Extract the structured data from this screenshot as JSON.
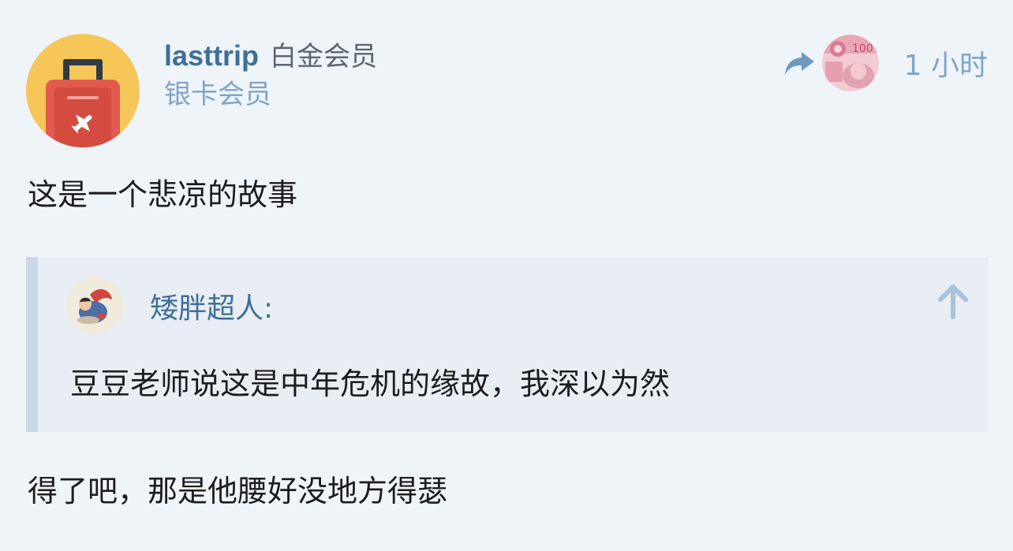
{
  "post": {
    "author": {
      "username": "lasttrip",
      "tier_primary": "白金会员",
      "tier_secondary": "银卡会员",
      "avatar_icon": "suitcase-icon"
    },
    "meta": {
      "share_icon": "share-arrow-icon",
      "time": "1 小时"
    },
    "body_first": "这是一个悲凉的故事",
    "quote": {
      "author": "矮胖超人:",
      "text": "豆豆老师说这是中年危机的缘故，我深以为然",
      "jump_icon": "arrow-up-icon"
    },
    "body_last": "得了吧，那是他腰好没地方得瑟"
  },
  "colors": {
    "background": "#eff4f9",
    "link_blue": "#3f6f9a",
    "muted_blue": "#7fa6c7",
    "quote_bg": "#e8eef3",
    "quote_border": "#c7d8e7",
    "avatar_yellow": "#f6c659",
    "suitcase_red": "#e05a4d"
  }
}
